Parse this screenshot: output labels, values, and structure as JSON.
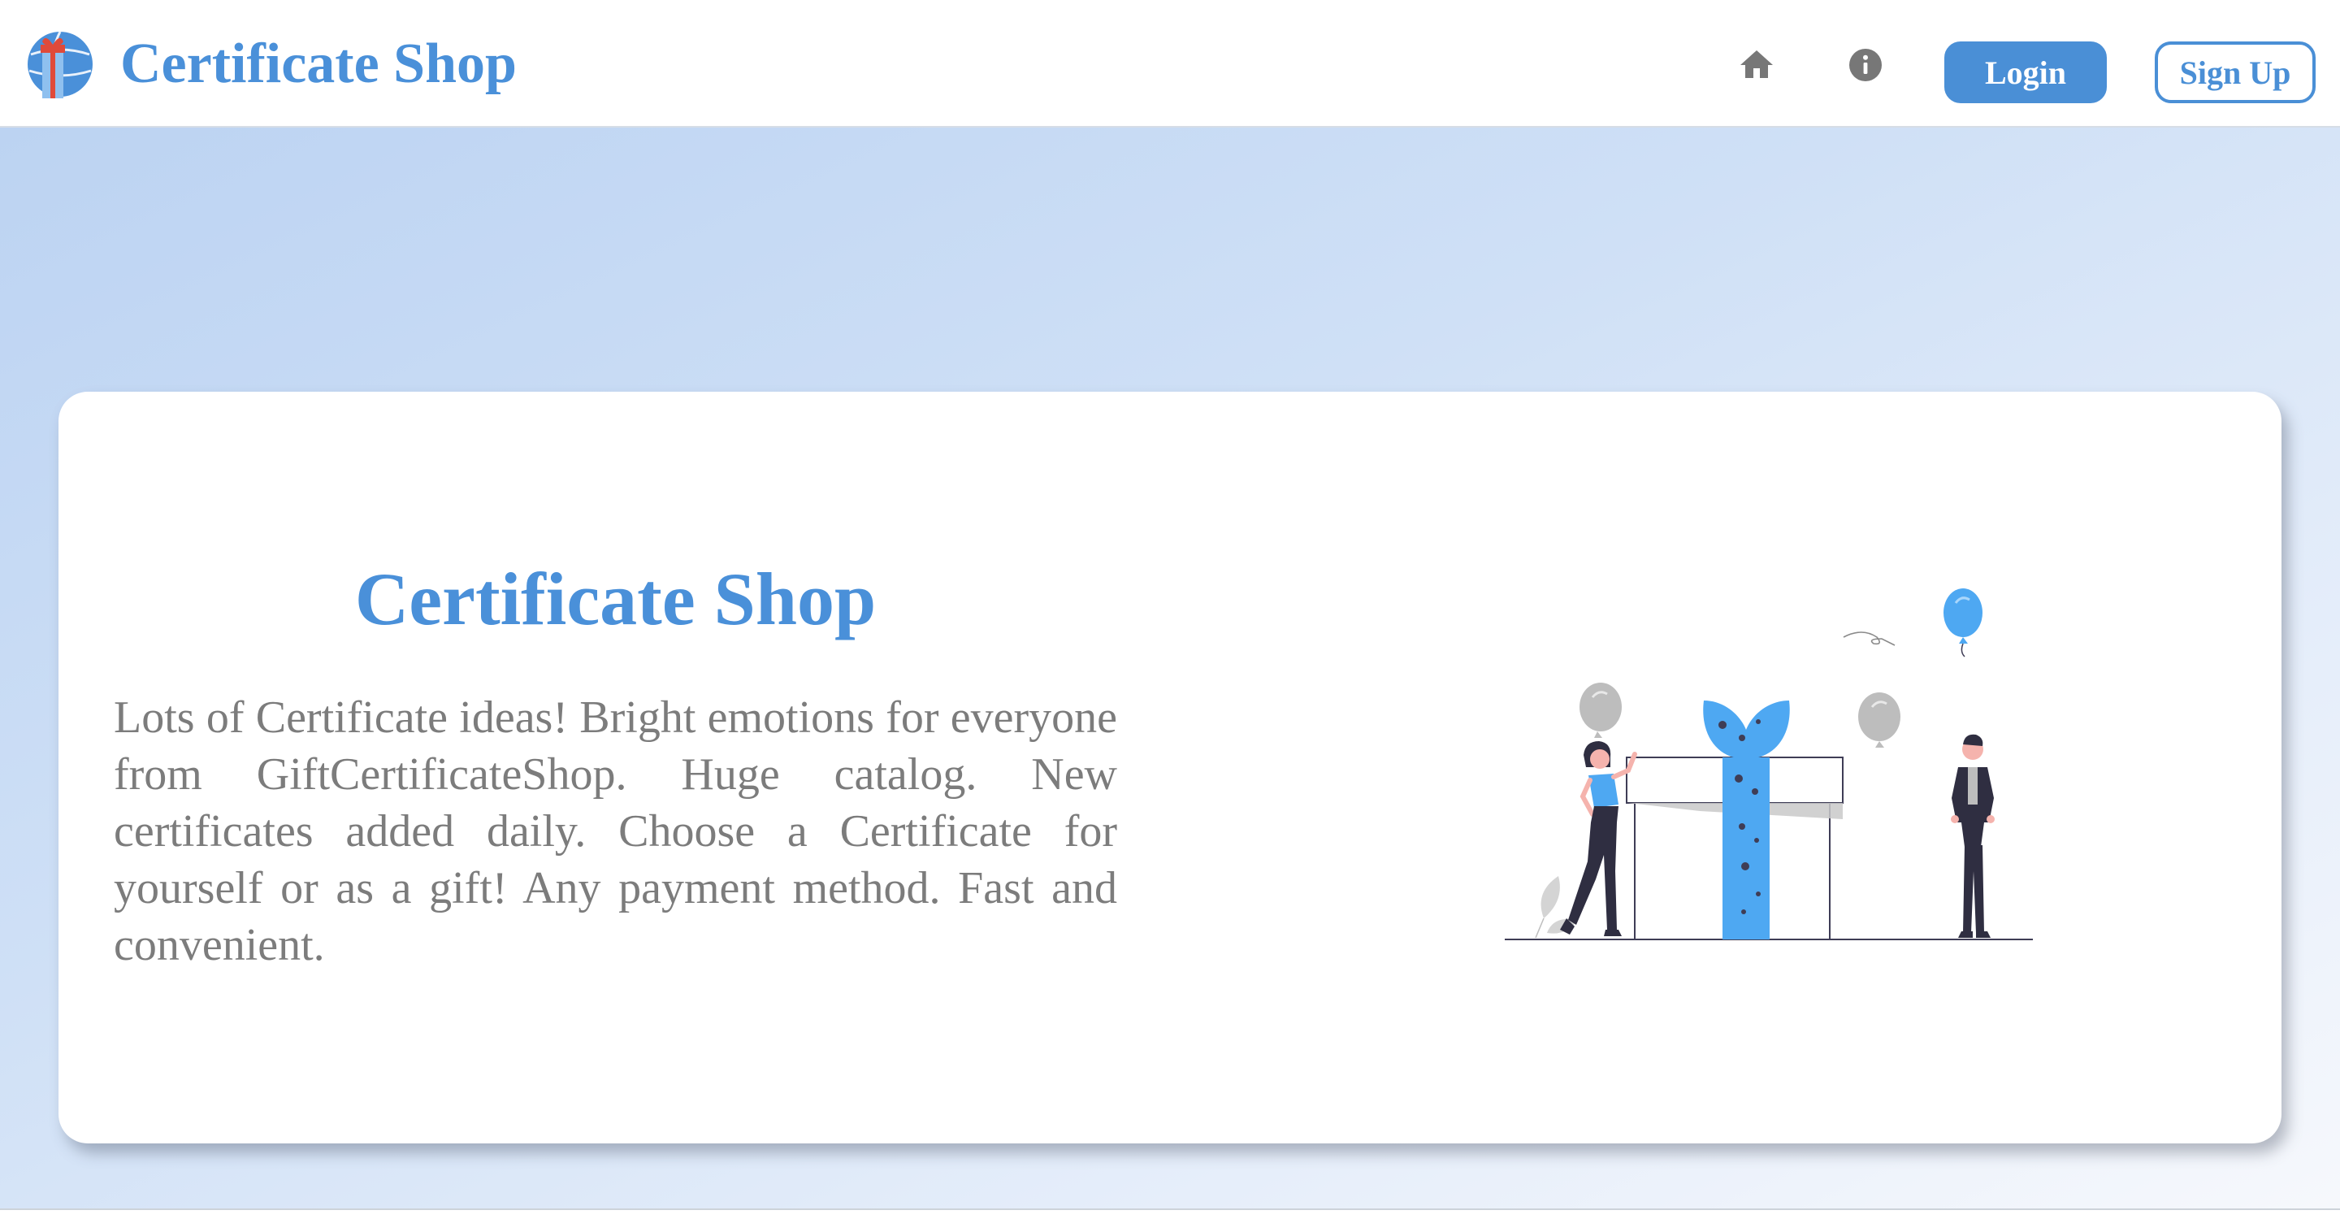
{
  "navbar": {
    "brand_title": "Certificate Shop",
    "logo_icon": "gift-globe-logo",
    "home_icon": "home-icon",
    "info_icon": "info-icon",
    "login_label": "Login",
    "signup_label": "Sign Up"
  },
  "hero": {
    "title": "Certificate Shop",
    "description": "Lots of Certificate ideas! Bright emotions for everyone from GiftCertificateShop. Huge catalog. New certificates added daily. Choose a Certificate for yourself or as a gift! Any payment method. Fast and convenient.",
    "illustration": "people-with-gift-box-illustration"
  },
  "colors": {
    "accent": "#4a90d9",
    "button_fill": "#4a8fd6",
    "body_text": "#7c7c7c",
    "icon_gray": "#777777",
    "illustration_blue": "#4ea8f2",
    "background_gradient_start": "#bcd3f2",
    "background_gradient_end": "#f6f8fc"
  }
}
